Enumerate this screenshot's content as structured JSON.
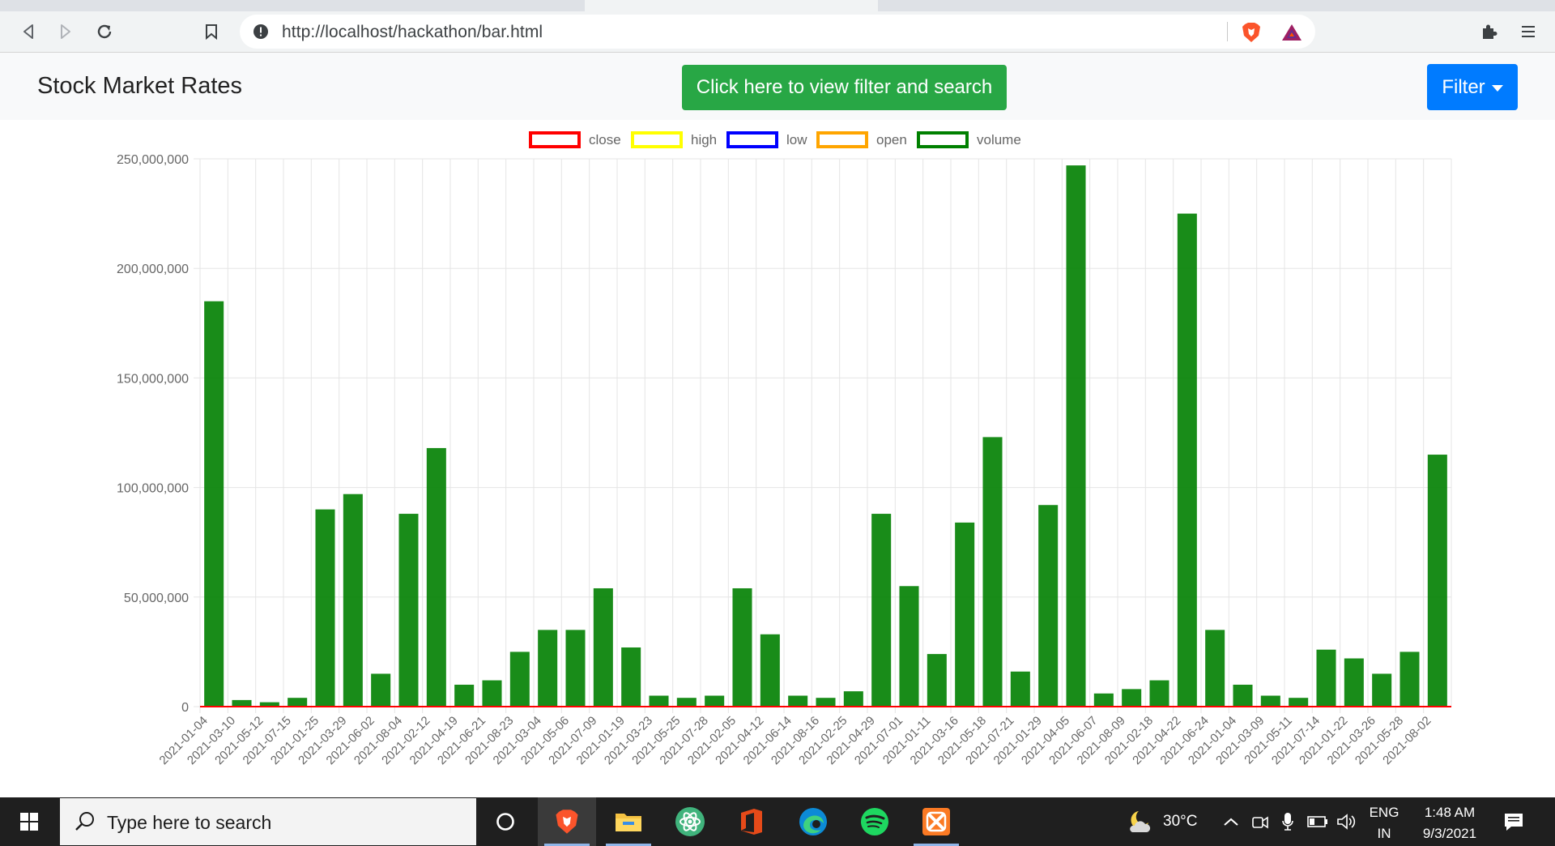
{
  "browser": {
    "url": "http://localhost/hackathon/bar.html"
  },
  "navbar": {
    "brand": "Stock Market Rates",
    "view_filter_button": "Click here to view filter and search",
    "filter_button": "Filter"
  },
  "chart_data": {
    "type": "bar",
    "title": "",
    "xlabel": "",
    "ylabel": "",
    "ylim": [
      0,
      250000000
    ],
    "y_ticks": [
      "0",
      "50,000,000",
      "100,000,000",
      "150,000,000",
      "200,000,000",
      "250,000,000"
    ],
    "legend_position": "top",
    "grid": true,
    "series": [
      {
        "name": "close",
        "color": "#ff0000",
        "values": [
          0,
          0,
          0,
          0,
          0,
          0,
          0,
          0,
          0,
          0,
          0,
          0,
          0,
          0,
          0,
          0,
          0,
          0,
          0,
          0,
          0,
          0,
          0,
          0,
          0,
          0,
          0,
          0,
          0,
          0,
          0,
          0,
          0,
          0,
          0,
          0,
          0,
          0,
          0,
          0,
          0,
          0,
          0,
          0,
          0
        ]
      },
      {
        "name": "high",
        "color": "#ffff00",
        "values": [
          0,
          0,
          0,
          0,
          0,
          0,
          0,
          0,
          0,
          0,
          0,
          0,
          0,
          0,
          0,
          0,
          0,
          0,
          0,
          0,
          0,
          0,
          0,
          0,
          0,
          0,
          0,
          0,
          0,
          0,
          0,
          0,
          0,
          0,
          0,
          0,
          0,
          0,
          0,
          0,
          0,
          0,
          0,
          0,
          0
        ]
      },
      {
        "name": "low",
        "color": "#0000ff",
        "values": [
          0,
          0,
          0,
          0,
          0,
          0,
          0,
          0,
          0,
          0,
          0,
          0,
          0,
          0,
          0,
          0,
          0,
          0,
          0,
          0,
          0,
          0,
          0,
          0,
          0,
          0,
          0,
          0,
          0,
          0,
          0,
          0,
          0,
          0,
          0,
          0,
          0,
          0,
          0,
          0,
          0,
          0,
          0,
          0,
          0
        ]
      },
      {
        "name": "open",
        "color": "#ffa500",
        "values": [
          0,
          0,
          0,
          0,
          0,
          0,
          0,
          0,
          0,
          0,
          0,
          0,
          0,
          0,
          0,
          0,
          0,
          0,
          0,
          0,
          0,
          0,
          0,
          0,
          0,
          0,
          0,
          0,
          0,
          0,
          0,
          0,
          0,
          0,
          0,
          0,
          0,
          0,
          0,
          0,
          0,
          0,
          0,
          0,
          0
        ]
      },
      {
        "name": "volume",
        "color": "#008000",
        "values": [
          185000000,
          3000000,
          2000000,
          4000000,
          90000000,
          97000000,
          15000000,
          88000000,
          118000000,
          10000000,
          12000000,
          25000000,
          35000000,
          35000000,
          54000000,
          27000000,
          5000000,
          4000000,
          5000000,
          54000000,
          33000000,
          5000000,
          4000000,
          7000000,
          88000000,
          55000000,
          24000000,
          84000000,
          123000000,
          16000000,
          92000000,
          247000000,
          6000000,
          8000000,
          12000000,
          225000000,
          35000000,
          10000000,
          5000000,
          4000000,
          26000000,
          22000000,
          15000000,
          25000000,
          115000000
        ]
      }
    ],
    "categories": [
      "2021-01-04",
      "2021-03-10",
      "2021-05-12",
      "2021-07-15",
      "2021-01-25",
      "2021-03-29",
      "2021-06-02",
      "2021-08-04",
      "2021-02-12",
      "2021-04-19",
      "2021-06-21",
      "2021-08-23",
      "2021-03-04",
      "2021-05-06",
      "2021-07-09",
      "2021-01-19",
      "2021-03-23",
      "2021-05-25",
      "2021-07-28",
      "2021-02-05",
      "2021-04-12",
      "2021-06-14",
      "2021-08-16",
      "2021-02-25",
      "2021-04-29",
      "2021-07-01",
      "2021-01-11",
      "2021-03-16",
      "2021-05-18",
      "2021-07-21",
      "2021-01-29",
      "2021-04-05",
      "2021-06-07",
      "2021-08-09",
      "2021-02-18",
      "2021-04-22",
      "2021-06-24",
      "2021-01-04",
      "2021-03-09",
      "2021-05-11",
      "2021-07-14",
      "2021-01-22",
      "2021-03-26",
      "2021-05-28",
      "2021-08-02"
    ]
  },
  "taskbar": {
    "search_placeholder": "Type here to search",
    "weather": "30°C",
    "lang_top": "ENG",
    "lang_bottom": "IN",
    "time": "1:48 AM",
    "date": "9/3/2021"
  }
}
